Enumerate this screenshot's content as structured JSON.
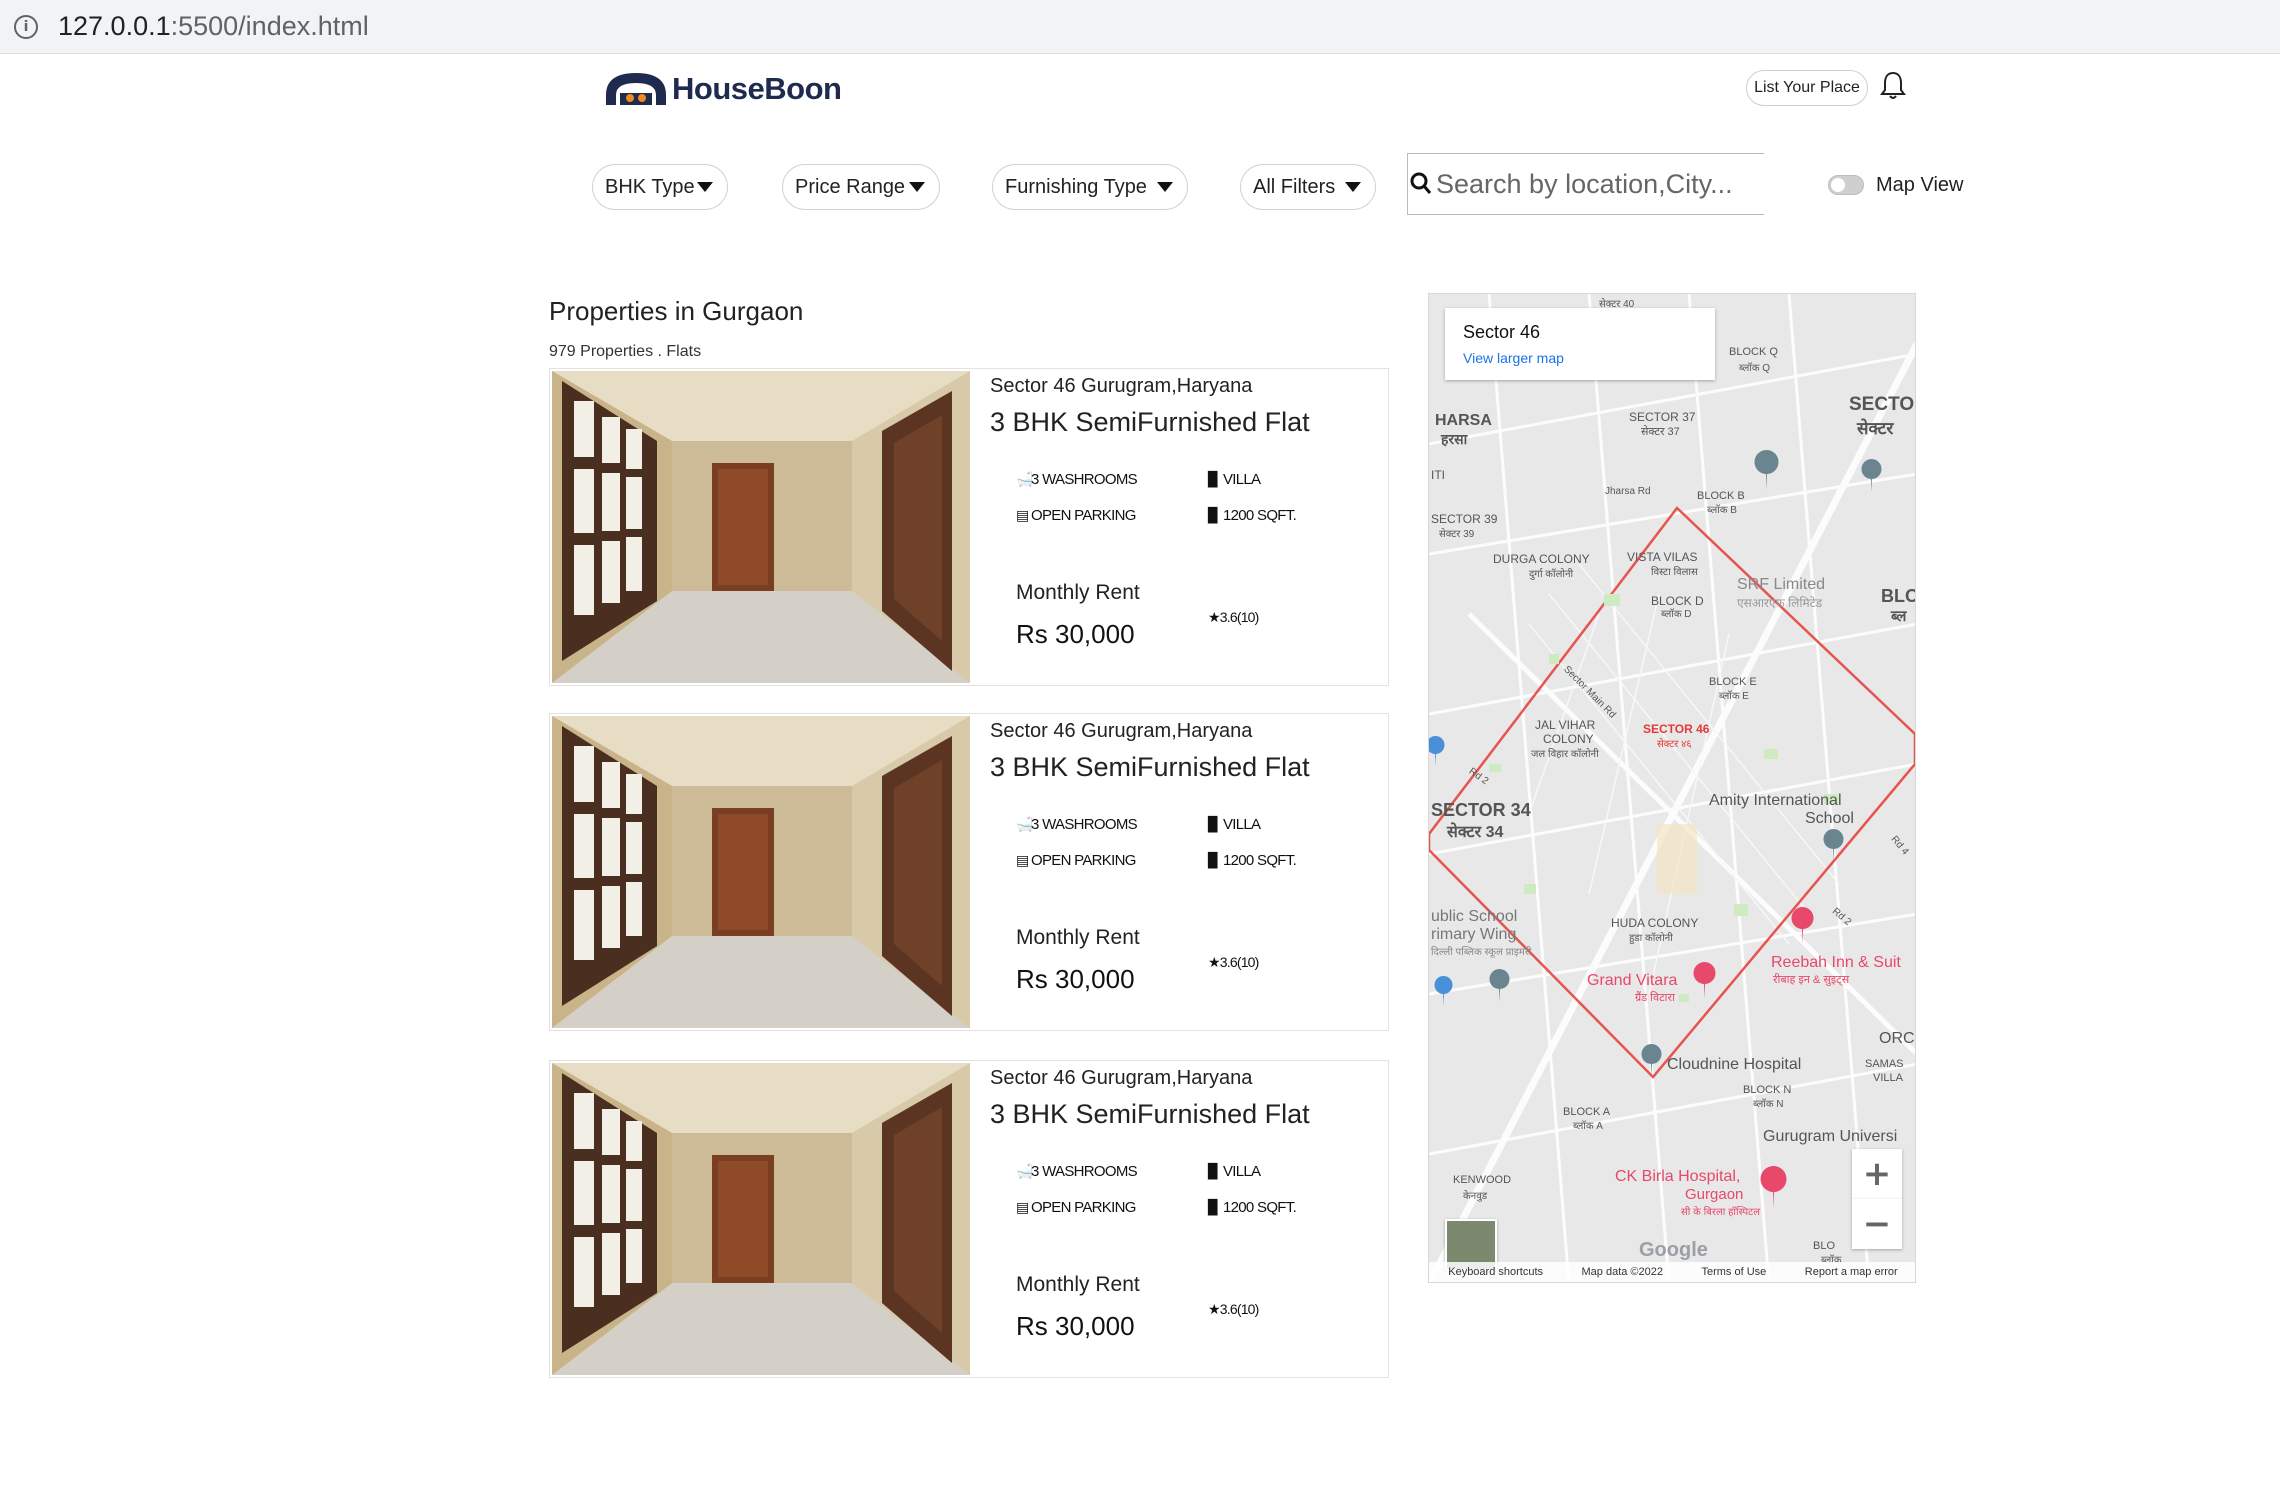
{
  "browser": {
    "url_host": "127.0.0.1",
    "url_path": ":5500/index.html"
  },
  "header": {
    "brand": "HouseBoon",
    "list_button": "List Your Place"
  },
  "filters": {
    "bhk": "BHK Type",
    "price": "Price Range",
    "furnishing": "Furnishing Type",
    "all": "All Filters",
    "search_placeholder": "Search by location,City...",
    "map_view_label": "Map View",
    "map_view_on": false
  },
  "listing": {
    "heading": "Properties in Gurgaon",
    "subheading": "979 Properties . Flats",
    "cards": [
      {
        "location": "Sector 46 Gurugram,Haryana",
        "title": "3 BHK SemiFurnished Flat",
        "washrooms": "3 WASHROOMS",
        "type": "VILLA",
        "parking": "OPEN PARKING",
        "area": "1200 SQFT.",
        "rent_label": "Monthly Rent",
        "rent": "Rs 30,000",
        "rating": "3.6(10)"
      },
      {
        "location": "Sector 46 Gurugram,Haryana",
        "title": "3 BHK SemiFurnished Flat",
        "washrooms": "3 WASHROOMS",
        "type": "VILLA",
        "parking": "OPEN PARKING",
        "area": "1200 SQFT.",
        "rent_label": "Monthly Rent",
        "rent": "Rs 30,000",
        "rating": "3.6(10)"
      },
      {
        "location": "Sector 46 Gurugram,Haryana",
        "title": "3 BHK SemiFurnished Flat",
        "washrooms": "3 WASHROOMS",
        "type": "VILLA",
        "parking": "OPEN PARKING",
        "area": "1200 SQFT.",
        "rent_label": "Monthly Rent",
        "rent": "Rs 30,000",
        "rating": "3.6(10)"
      }
    ]
  },
  "map": {
    "place_title": "Sector 46",
    "larger_map_link": "View larger map",
    "zoom_in": "+",
    "zoom_out": "−",
    "google": "Google",
    "footer": [
      "Keyboard shortcuts",
      "Map data ©2022",
      "Terms of Use",
      "Report a map error"
    ],
    "labels": {
      "sector40": "सेक्टर 40",
      "block_q": "BLOCK Q",
      "block_q_hi": "ब्लॉक Q",
      "sector_right": "SECTO",
      "sector_right_hi": "सेक्टर",
      "harsa": "HARSA",
      "harsa_hi": "हरसा",
      "sector37": "SECTOR 37",
      "sector37_hi": "सेक्टर 37",
      "iti": "ITI",
      "jharsa_rd": "Jharsa Rd",
      "block_b": "BLOCK B",
      "block_b_hi": "ब्लॉक B",
      "sector39": "SECTOR 39",
      "sector39_hi": "सेक्टर 39",
      "durga_colony": "DURGA COLONY",
      "durga_colony_hi": "दुर्गा कॉलोनी",
      "vista_vilas": "VISTA VILAS",
      "vista_vilas_hi": "विस्टा विलास",
      "srf": "SRF Limited",
      "srf_hi": "एसआरएफ लिमिटेड",
      "block_d": "BLOCK D",
      "block_d_hi": "ब्लॉक D",
      "blc": "BLO",
      "blc_hi": "ब्ल",
      "sector_main_rd": "Sector Main Rd",
      "block_e": "BLOCK E",
      "block_e_hi": "ब्लॉक E",
      "jal_vihar": "JAL VIHAR",
      "jal_vihar_2": "COLONY",
      "jal_vihar_hi": "जल विहार कॉलोनी",
      "sector46": "SECTOR 46",
      "sector46_hi": "सेक्टर ४६",
      "rd2": "Rd 2",
      "amity": "Amity International",
      "amity_2": "School",
      "sector34": "SECTOR 34",
      "sector34_hi": "सेक्टर 34",
      "rd4": "Rd 4",
      "public_school": "ublic School",
      "primary_wing": "rimary Wing",
      "public_hi": "दिल्ली पब्लिक स्कूल प्राइमरी",
      "huda_colony": "HUDA COLONY",
      "huda_hi": "हुडा कॉलोनी",
      "rd2b": "Rd 2",
      "grand_vitara": "Grand Vitara",
      "grand_vitara_hi": "ग्रैंड विटारा",
      "reebah": "Reebah Inn & Suit",
      "reebah_hi": "रीबाह इन & सुइट्स",
      "orc": "ORC",
      "samas": "SAMAS",
      "villa": "VILLA",
      "cloudnine": "Cloudnine Hospital",
      "block_n": "BLOCK N",
      "block_n_hi": "ब्लॉक N",
      "block_a": "BLOCK A",
      "block_a_hi": "ब्लॉक A",
      "gurugram_univ": "Gurugram Universi",
      "kenwood": "KENWOOD",
      "kenwood_hi": "केनवुड",
      "ck_birla": "CK Birla Hospital,",
      "ck_birla_2": "Gurgaon",
      "ck_birla_hi": "सी के बिरला हॉस्पिटल",
      "blo_bottom": "BLO",
      "blo_bottom_hi": "ब्लॉक"
    }
  },
  "colors": {
    "brand_dark": "#1f2a4f",
    "brand_orange": "#f08a24",
    "boundary": "#e53935",
    "map_link": "#1a73e8",
    "pin": "#6b8590",
    "pin_red": "#e8486a"
  }
}
